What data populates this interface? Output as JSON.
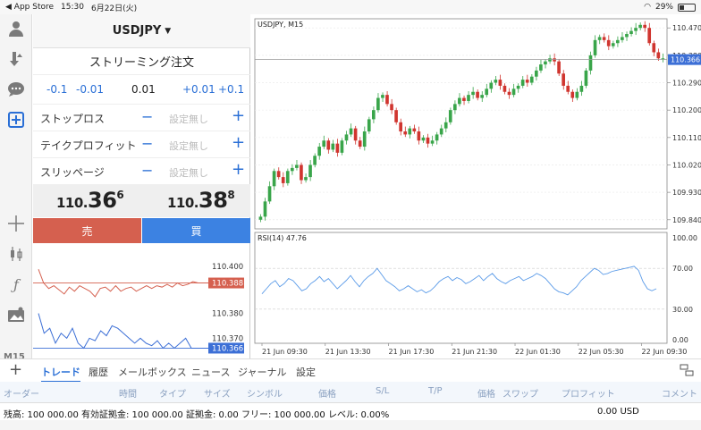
{
  "status": {
    "app_back": "App Store",
    "time": "15:30",
    "date": "6月22日(火)",
    "battery": "29%"
  },
  "left_toolbar": {
    "icons": [
      "account-icon",
      "trade-arrows-icon",
      "chat-icon",
      "new-order-icon",
      "crosshair-icon",
      "candles-icon",
      "indicator-f-icon",
      "objects-icon"
    ],
    "timeframe": "M15"
  },
  "order": {
    "symbol": "USDJPY",
    "symbol_caret": "▼",
    "type": "ストリーミング注文",
    "lot_steps": [
      "-0.1",
      "-0.01",
      "0.01",
      "+0.01",
      "+0.1"
    ],
    "params": [
      {
        "label": "ストップロス",
        "value": "設定無し"
      },
      {
        "label": "テイクプロフィット",
        "value": "設定無し"
      },
      {
        "label": "スリッページ",
        "value": "設定無し"
      }
    ],
    "minus": "−",
    "plus": "+",
    "bid": {
      "main": "110.",
      "big": "36",
      "sup": "6"
    },
    "ask": {
      "main": "110.",
      "big": "38",
      "sup": "8"
    },
    "sell_label": "売",
    "buy_label": "買"
  },
  "tick_charts": {
    "upper": {
      "levels": [
        "110.400",
        "110.388"
      ],
      "current": "110.388",
      "color": "#d5604f",
      "values": [
        110.398,
        110.388,
        110.384,
        110.386,
        110.383,
        110.38,
        110.385,
        110.382,
        110.386,
        110.384,
        110.382,
        110.378,
        110.384,
        110.385,
        110.382,
        110.386,
        110.382,
        110.384,
        110.385,
        110.382,
        110.384,
        110.386,
        110.384,
        110.386,
        110.385,
        110.387,
        110.385,
        110.388,
        110.386,
        110.387,
        110.389,
        110.388,
        110.388,
        110.388
      ]
    },
    "lower": {
      "levels": [
        "110.380",
        "110.370",
        "110.366"
      ],
      "current": "110.366",
      "color": "#3c6fd6",
      "values": [
        110.38,
        110.372,
        110.374,
        110.368,
        110.372,
        110.37,
        110.374,
        110.368,
        110.366,
        110.37,
        110.369,
        110.373,
        110.371,
        110.375,
        110.374,
        110.372,
        110.37,
        110.368,
        110.37,
        110.368,
        110.367,
        110.369,
        110.366,
        110.368,
        110.366,
        110.368,
        110.37,
        110.366,
        110.366,
        110.366,
        110.366
      ]
    }
  },
  "chart": {
    "title": "USDJPY, M15",
    "current_price": "110.366",
    "price_labels": [
      "110.470",
      "110.380",
      "110.290",
      "110.200",
      "110.110",
      "110.020",
      "109.930",
      "109.840"
    ],
    "price_label_values": [
      110.47,
      110.38,
      110.29,
      110.2,
      110.11,
      110.02,
      109.93,
      109.84
    ],
    "price_range": [
      109.81,
      110.5
    ],
    "time_labels": [
      "21 Jun 09:30",
      "21 Jun 13:30",
      "21 Jun 17:30",
      "21 Jun 21:30",
      "22 Jun 01:30",
      "22 Jun 05:30",
      "22 Jun 09:30"
    ],
    "up_color": "#39a54a",
    "down_color": "#d0352f",
    "closes": [
      109.85,
      109.9,
      109.95,
      110.0,
      109.98,
      109.96,
      110.0,
      110.01,
      110.02,
      109.97,
      109.98,
      110.02,
      110.05,
      110.08,
      110.1,
      110.07,
      110.09,
      110.06,
      110.1,
      110.12,
      110.14,
      110.1,
      110.08,
      110.13,
      110.17,
      110.2,
      110.24,
      110.25,
      110.22,
      110.2,
      110.16,
      110.13,
      110.12,
      110.14,
      110.13,
      110.1,
      110.11,
      110.09,
      110.1,
      110.12,
      110.14,
      110.16,
      110.2,
      110.22,
      110.24,
      110.23,
      110.25,
      110.26,
      110.24,
      110.25,
      110.27,
      110.29,
      110.3,
      110.28,
      110.26,
      110.25,
      110.27,
      110.28,
      110.3,
      110.29,
      110.31,
      110.33,
      110.35,
      110.36,
      110.37,
      110.36,
      110.32,
      110.28,
      110.26,
      110.24,
      110.26,
      110.28,
      110.33,
      110.38,
      110.43,
      110.44,
      110.43,
      110.41,
      110.42,
      110.43,
      110.44,
      110.45,
      110.46,
      110.47,
      110.48,
      110.47,
      110.42,
      110.39,
      110.37,
      110.37
    ],
    "rsi_label": "RSI(14) 47.76",
    "rsi_levels": [
      "100.00",
      "70.00",
      "30.00",
      "0.00"
    ],
    "rsi_level_values": [
      100,
      70,
      30,
      0
    ],
    "rsi_values": [
      45,
      50,
      55,
      58,
      52,
      55,
      60,
      58,
      53,
      48,
      50,
      55,
      58,
      62,
      57,
      60,
      55,
      50,
      54,
      58,
      63,
      57,
      52,
      58,
      62,
      65,
      70,
      64,
      58,
      55,
      52,
      48,
      50,
      53,
      50,
      47,
      49,
      46,
      48,
      52,
      57,
      60,
      62,
      58,
      61,
      59,
      55,
      57,
      60,
      63,
      58,
      62,
      65,
      60,
      57,
      55,
      58,
      60,
      62,
      58,
      60,
      62,
      65,
      63,
      60,
      55,
      50,
      47,
      46,
      44,
      48,
      52,
      58,
      62,
      66,
      70,
      68,
      64,
      65,
      67,
      68,
      69,
      70,
      71,
      72,
      68,
      57,
      50,
      48,
      50
    ]
  },
  "tabs": {
    "add": "+",
    "items": [
      "トレード",
      "履歴",
      "メールボックス",
      "ニュース",
      "ジャーナル",
      "設定"
    ],
    "layout_icon": "layout-icon"
  },
  "columns": [
    "オーダー",
    "時間",
    "タイプ",
    "サイズ",
    "シンボル",
    "価格",
    "S/L",
    "T/P",
    "価格",
    "スワップ",
    "プロフィット",
    "コメント"
  ],
  "account": {
    "summary": "残高: 100 000.00 有効証拠金: 100 000.00 証拠金: 0.00 フリー: 100 000.00 レベル: 0.00%",
    "total": "0.00  USD"
  }
}
